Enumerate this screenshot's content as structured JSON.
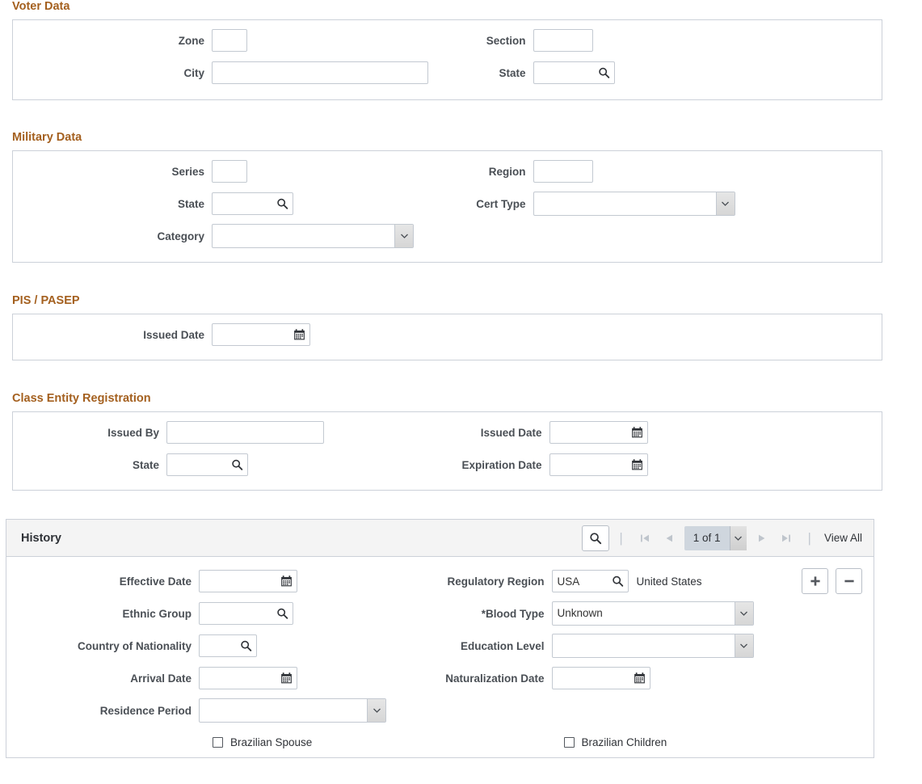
{
  "sections": {
    "voter": {
      "title": "Voter Data",
      "fields": {
        "zone": {
          "label": "Zone",
          "value": ""
        },
        "city": {
          "label": "City",
          "value": ""
        },
        "section": {
          "label": "Section",
          "value": ""
        },
        "state": {
          "label": "State",
          "value": ""
        }
      }
    },
    "military": {
      "title": "Military Data",
      "fields": {
        "series": {
          "label": "Series",
          "value": ""
        },
        "state": {
          "label": "State",
          "value": ""
        },
        "category": {
          "label": "Category",
          "value": ""
        },
        "region": {
          "label": "Region",
          "value": ""
        },
        "cert_type": {
          "label": "Cert Type",
          "value": ""
        }
      }
    },
    "pis": {
      "title": "PIS / PASEP",
      "fields": {
        "issued_date": {
          "label": "Issued Date",
          "value": ""
        }
      }
    },
    "class_entity": {
      "title": "Class Entity Registration",
      "fields": {
        "issued_by": {
          "label": "Issued By",
          "value": ""
        },
        "state": {
          "label": "State",
          "value": ""
        },
        "issued_date": {
          "label": "Issued Date",
          "value": ""
        },
        "expiration_date": {
          "label": "Expiration Date",
          "value": ""
        }
      }
    },
    "history": {
      "title": "History",
      "nav": {
        "page_indicator": "1 of 1",
        "view_all": "View All",
        "search_icon": "search-icon",
        "first_icon": "first-page-icon",
        "prev_icon": "previous-page-icon",
        "next_icon": "next-page-icon",
        "last_icon": "last-page-icon"
      },
      "row_actions": {
        "add": "+",
        "delete": "−"
      },
      "fields": {
        "effective_date": {
          "label": "Effective Date",
          "value": ""
        },
        "ethnic_group": {
          "label": "Ethnic Group",
          "value": ""
        },
        "country_of_nationality": {
          "label": "Country of Nationality",
          "value": ""
        },
        "arrival_date": {
          "label": "Arrival Date",
          "value": ""
        },
        "residence_period": {
          "label": "Residence Period",
          "value": ""
        },
        "regulatory_region": {
          "label": "Regulatory Region",
          "value": "USA",
          "description": "United States"
        },
        "blood_type": {
          "label": "*Blood Type",
          "value": "Unknown"
        },
        "education_level": {
          "label": "Education Level",
          "value": ""
        },
        "naturalization_date": {
          "label": "Naturalization Date",
          "value": ""
        },
        "brazilian_spouse": {
          "label": "Brazilian Spouse",
          "checked": false
        },
        "brazilian_children": {
          "label": "Brazilian Children",
          "checked": false
        }
      }
    }
  },
  "colors": {
    "section_heading": "#a4601f",
    "panel_border": "#ccd1d9",
    "input_border": "#c3c9d1",
    "label_text": "#4a4f55",
    "grid_header_bg": "#f4f4f4",
    "pager_bg": "#cfd6de",
    "arrow_disabled": "#bfc5cc"
  }
}
